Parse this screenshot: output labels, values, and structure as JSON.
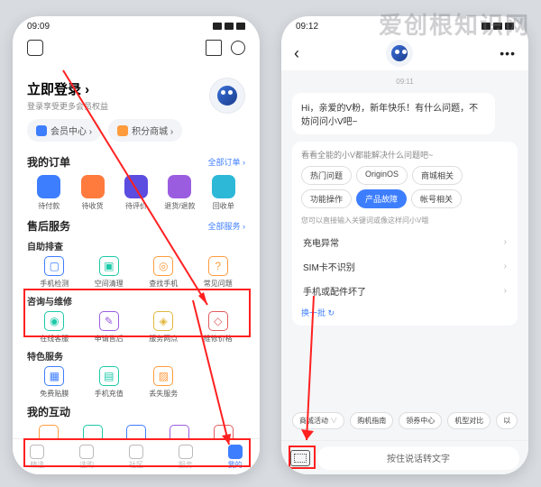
{
  "watermark": "爱创根知识网",
  "left": {
    "status_time": "09:09",
    "login_title": "立即登录 ›",
    "login_sub": "登录享受更多会员权益",
    "chips": [
      {
        "label": "会员中心 ›"
      },
      {
        "label": "积分商城 ›"
      }
    ],
    "orders": {
      "title": "我的订单",
      "link": "全部订单 ›",
      "items": [
        {
          "label": "待付款"
        },
        {
          "label": "待收货"
        },
        {
          "label": "待评价"
        },
        {
          "label": "退货/退款"
        },
        {
          "label": "回收单"
        }
      ]
    },
    "after": {
      "title": "售后服务",
      "link": "全部服务 ›",
      "g1_title": "自助排查",
      "g1": [
        {
          "label": "手机检测"
        },
        {
          "label": "空间清理"
        },
        {
          "label": "查找手机"
        },
        {
          "label": "常见问题"
        }
      ],
      "g2_title": "咨询与维修",
      "g2": [
        {
          "label": "在线客服"
        },
        {
          "label": "申请售后"
        },
        {
          "label": "服务网点"
        },
        {
          "label": "维修价格"
        }
      ],
      "g3_title": "特色服务",
      "g3": [
        {
          "label": "免费贴膜"
        },
        {
          "label": "手机充值"
        },
        {
          "label": "丢失服务"
        }
      ]
    },
    "interact_title": "我的互动",
    "tabs": [
      {
        "label": "精选"
      },
      {
        "label": "选购"
      },
      {
        "label": "社区"
      },
      {
        "label": "服务"
      },
      {
        "label": "我的"
      }
    ]
  },
  "right": {
    "status_time": "09:12",
    "chat_time": "09:11",
    "greeting": "Hi，亲爱的V粉，新年快乐！有什么问题，不妨问问小V吧~",
    "b2_title": "看看全能的小V都能解决什么问题吧~",
    "pills": [
      {
        "label": "热门问题"
      },
      {
        "label": "OriginOS"
      },
      {
        "label": "商城相关"
      },
      {
        "label": "功能操作"
      },
      {
        "label": "产品故障",
        "active": true
      },
      {
        "label": "帐号相关"
      }
    ],
    "b2_sub": "您可以直接输入关键词或像这样问小V哦",
    "questions": [
      {
        "label": "充电异常"
      },
      {
        "label": "SIM卡不识别"
      },
      {
        "label": "手机或配件坏了"
      }
    ],
    "refresh": "换一批 ↻",
    "bottom_pills": [
      {
        "label": "商城活动"
      },
      {
        "label": "购机指南"
      },
      {
        "label": "领券中心"
      },
      {
        "label": "机型对比"
      },
      {
        "label": "以"
      }
    ],
    "voice_btn": "按住说话转文字"
  }
}
